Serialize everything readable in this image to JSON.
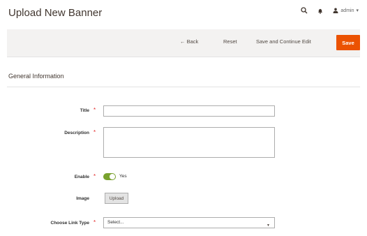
{
  "header": {
    "title": "Upload New Banner",
    "user_label": "admin",
    "search_icon": "search-icon",
    "bell_icon": "bell-icon",
    "user_icon": "user-icon"
  },
  "actions": {
    "back_label": "Back",
    "reset_label": "Reset",
    "save_continue_label": "Save and Continue Edit",
    "save_label": "Save"
  },
  "section": {
    "title": "General Information"
  },
  "fields": {
    "title_label": "Title",
    "title_value": "",
    "description_label": "Description",
    "description_value": "",
    "enable_label": "Enable",
    "enable_value": "Yes",
    "image_label": "Image",
    "upload_label": "Upload",
    "link_type_label": "Choose Link Type",
    "link_type_selected": "Select..."
  },
  "colors": {
    "accent": "#eb5202",
    "toggle_on": "#79a22e",
    "required": "#e22626"
  }
}
